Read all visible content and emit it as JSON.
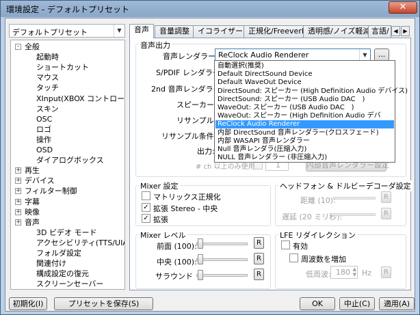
{
  "window": {
    "title": "環境設定 - デフォルトプリセット",
    "close": "✕"
  },
  "preset": {
    "selected": "デフォルトプリセット"
  },
  "tree": [
    {
      "label": "全般",
      "expander": "-"
    },
    {
      "label": "起動時"
    },
    {
      "label": "ショートカット"
    },
    {
      "label": "マウス"
    },
    {
      "label": "タッチ"
    },
    {
      "label": "XInput(XBOX コントローラ)"
    },
    {
      "label": "スキン"
    },
    {
      "label": "OSC"
    },
    {
      "label": "ロゴ"
    },
    {
      "label": "操作"
    },
    {
      "label": "OSD"
    },
    {
      "label": "ダイアログボックス"
    },
    {
      "label": "再生",
      "expander": "+"
    },
    {
      "label": "デバイス",
      "expander": "+"
    },
    {
      "label": "フィルター制御",
      "expander": "+"
    },
    {
      "label": "字幕",
      "expander": "+"
    },
    {
      "label": "映像",
      "expander": "+"
    },
    {
      "label": "音声",
      "expander": "+"
    },
    {
      "label": "3D ビデオ モード"
    },
    {
      "label": "アクセシビリティ(TTS/UIA)"
    },
    {
      "label": "フォルダ設定"
    },
    {
      "label": "関連付け"
    },
    {
      "label": "構成設定の復元"
    },
    {
      "label": "スクリーンセーバー"
    }
  ],
  "tabs": [
    "音声",
    "音量調整",
    "イコライザー",
    "正規化/Freeverb",
    "透明感/ノイズ軽減",
    "言語/"
  ],
  "tab_nav": {
    "prev": "◀",
    "next": "▶"
  },
  "audio_output": {
    "group_title": "音声出力",
    "renderer_label": "音声レンダラー:",
    "renderer_value": "ReClock Audio Renderer",
    "browse": "...",
    "spdif_label": "S/PDIF レンダラー:",
    "second_label": "2nd 音声レンダラー:",
    "speaker_label": "スピーカー:",
    "resample_label": "リサンプル:",
    "resample_cond_label": "リサンプル条件:",
    "output_label": "出力:",
    "ch_label": "# ch 以上のみ使用",
    "ch_value": "1",
    "internal_button": "内部音声レンダラー設定"
  },
  "dropdown_items": [
    "自動選択(推奨)",
    "Default DirectSound Device",
    "Default WaveOut Device",
    "DirectSound: スピーカー (High Definition Audio デバイス)",
    "DirectSound: スピーカー (USB Audio DAC　)",
    "WaveOut: スピーカー (USB Audio DAC　)",
    "WaveOut: スピーカー (High Definition Audio デバ",
    "ReClock Audio Renderer",
    "内部 DirectSound 音声レンダラー(クロスフェード)",
    "内部 WASAPI 音声レンダラー",
    "Null 音声レンダラ(圧縮入力)",
    "NULL 音声レンダラー (非圧縮入力)"
  ],
  "dropdown_selected_index": 7,
  "mixer": {
    "title": "Mixer 設定",
    "matrix": "マトリックス正規化",
    "matrix_checked": false,
    "stereo": "拡張 Stereo - 中央",
    "stereo_checked": true,
    "expand": "拡張",
    "expand_checked": true
  },
  "headphone": {
    "title": "ヘッドフォン & ドルビーデコーダ設定",
    "distance": "距離 (10):",
    "delay": "遅延 (20 ミリ秒):",
    "reset": "R"
  },
  "mixer_level": {
    "title": "Mixer レベル",
    "front": "前面 (100):",
    "center": "中央 (100):",
    "surround": "サラウンド",
    "reset": "R"
  },
  "lfe": {
    "title": "LFE リダイレクション",
    "enable": "有効",
    "enable_checked": false,
    "increase": "周波数を増加",
    "increase_checked": false,
    "low_label": "低周波:",
    "low_value": "180",
    "hz": "Hz",
    "reset": "R"
  },
  "footer": {
    "init": "初期化(I)",
    "save_preset": "プリセットを保存(S)",
    "ok": "OK",
    "cancel": "中止(C)",
    "apply": "適用(A)"
  },
  "colors": {
    "selection": "#3399ff",
    "frame": "#bcd0e6",
    "group_border": "#d5dfe5"
  }
}
